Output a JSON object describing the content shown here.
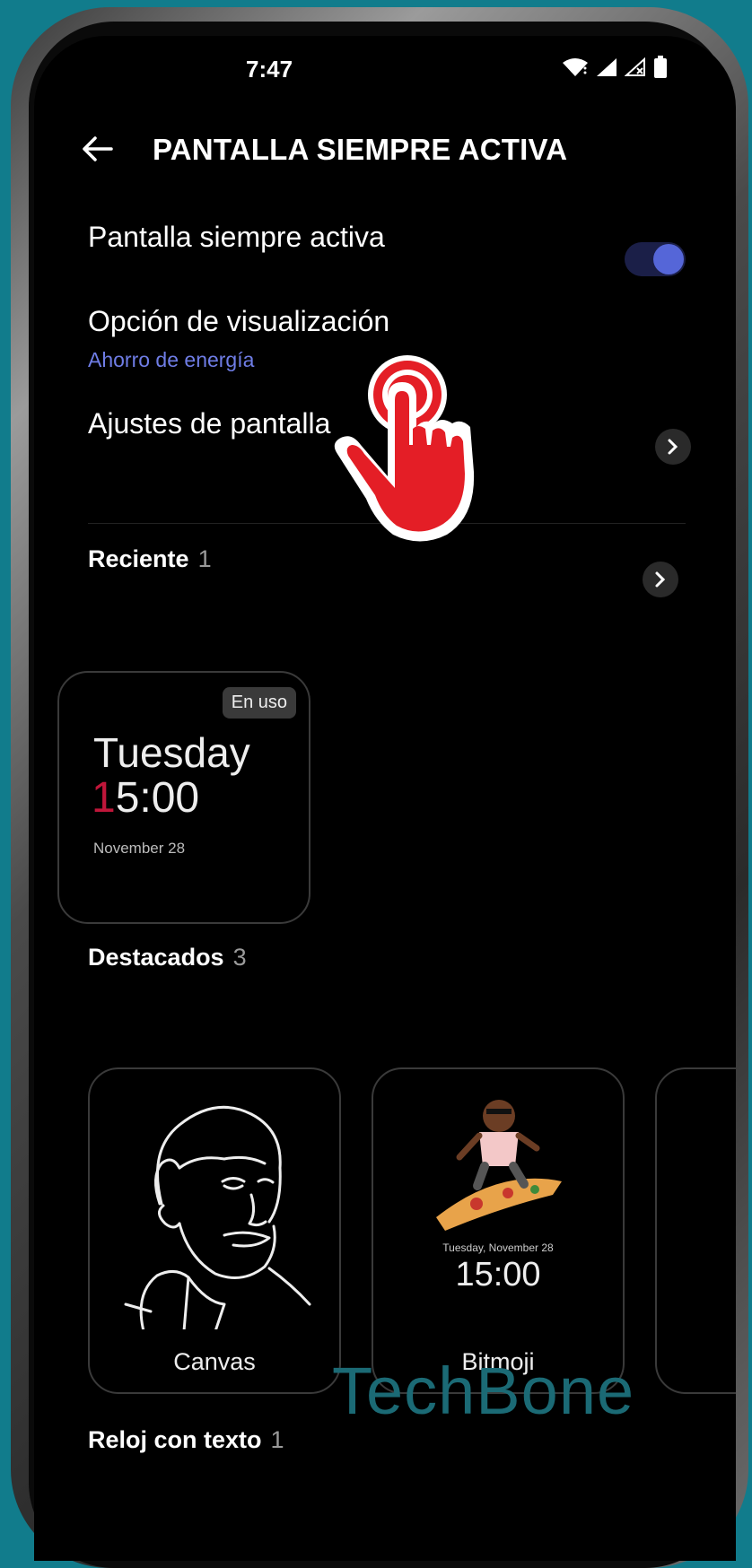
{
  "status_bar": {
    "time": "7:47",
    "icons": [
      "wifi-icon",
      "signal-icon",
      "signal-no-sim-icon",
      "battery-icon"
    ]
  },
  "header": {
    "title": "PANTALLA SIEMPRE ACTIVA"
  },
  "settings": {
    "always_on_label": "Pantalla siempre activa",
    "always_on_enabled": true,
    "display_option_label": "Opción de visualización",
    "display_option_value": "Ahorro de energía",
    "screen_settings_label": "Ajustes de pantalla"
  },
  "recent": {
    "title": "Reciente",
    "count": "1",
    "card": {
      "badge": "En uso",
      "day": "Tuesday",
      "time_first": "1",
      "time_rest": "5:00",
      "date": "November 28"
    }
  },
  "featured": {
    "title": "Destacados",
    "count": "3",
    "cards": [
      {
        "label": "Canvas"
      },
      {
        "label": "Bitmoji",
        "date": "Tuesday, November 28",
        "time": "15:00"
      }
    ]
  },
  "text_clock": {
    "title": "Reloj con texto",
    "count": "1"
  },
  "watermark": "TechBone",
  "colors": {
    "accent": "#5566d8",
    "link": "#6f7de6",
    "background": "#117c8c",
    "pointer": "#e41e26"
  }
}
